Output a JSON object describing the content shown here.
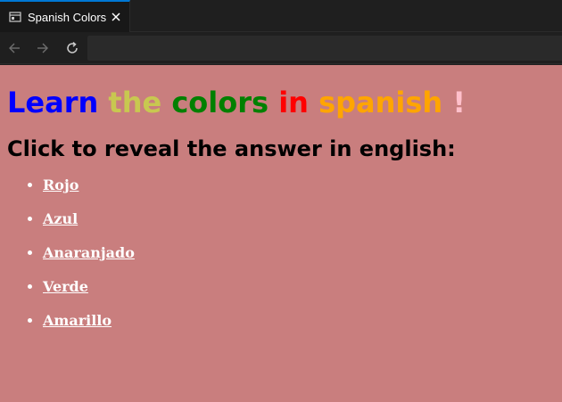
{
  "tab": {
    "title": "Spanish Colors"
  },
  "icons": {
    "tab": "browser-window-icon",
    "close": "close-icon",
    "back": "arrow-left-icon",
    "forward": "arrow-right-icon",
    "reload": "reload-icon"
  },
  "page": {
    "heading": [
      {
        "text": "Learn",
        "color": "#0000ff"
      },
      {
        "text": "the",
        "color": "#c8c850"
      },
      {
        "text": "colors",
        "color": "#008000"
      },
      {
        "text": "in",
        "color": "#ff0000"
      },
      {
        "text": "spanish",
        "color": "#ffa500"
      },
      {
        "text": "!",
        "color": "#ffc0cb"
      }
    ],
    "subheading": "Click to reveal the answer in english:",
    "items": [
      {
        "label": "Rojo"
      },
      {
        "label": "Azul"
      },
      {
        "label": "Anaranjado"
      },
      {
        "label": "Verde"
      },
      {
        "label": "Amarillo"
      }
    ]
  },
  "colors": {
    "page_background": "#c97e7e",
    "chrome_background": "#1f1f1f",
    "tab_accent": "#0078d4",
    "link": "#ffffff"
  }
}
